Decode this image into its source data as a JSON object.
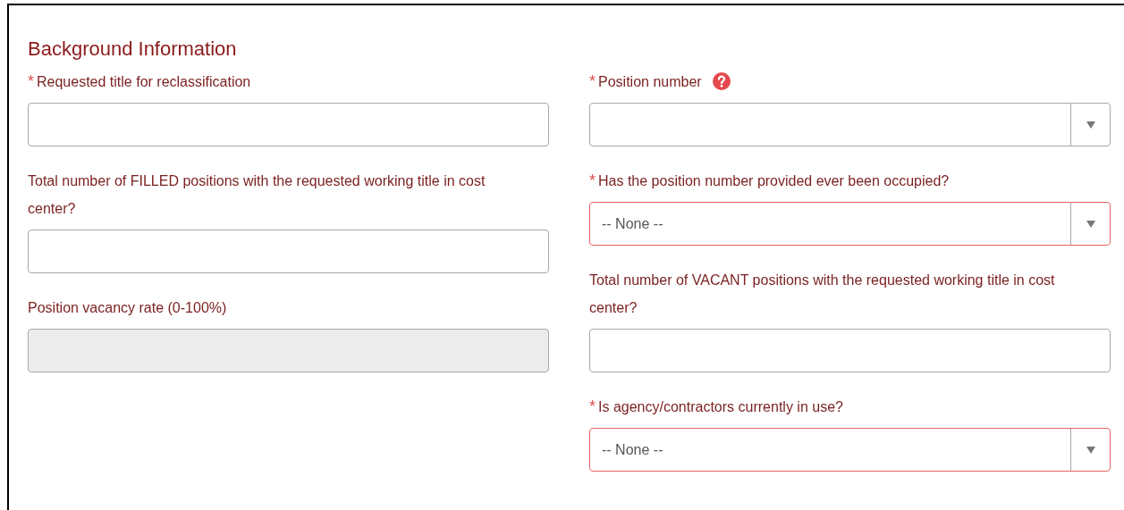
{
  "section_title": "Background Information",
  "columns": [
    {
      "fields": [
        {
          "kind": "text",
          "label": "Requested title for reclassification",
          "required": "*"
        },
        {
          "kind": "text",
          "label": "Total number of FILLED positions with the requested working title in cost center?"
        },
        {
          "kind": "readonly",
          "label": "Position vacancy rate (0-100%)"
        }
      ]
    },
    {
      "fields": [
        {
          "kind": "select",
          "label": "Position number",
          "required": "*",
          "help": true,
          "invalid": false
        },
        {
          "kind": "select",
          "label": "Has the position number provided ever been occupied?",
          "required": "*",
          "value": "-- None --",
          "invalid": true
        },
        {
          "kind": "text",
          "label": "Total number of VACANT positions with the requested working title in cost center?"
        },
        {
          "kind": "select",
          "label": "Is agency/contractors currently in use?",
          "required": "*",
          "value": "-- None --",
          "invalid": true
        }
      ]
    }
  ]
}
